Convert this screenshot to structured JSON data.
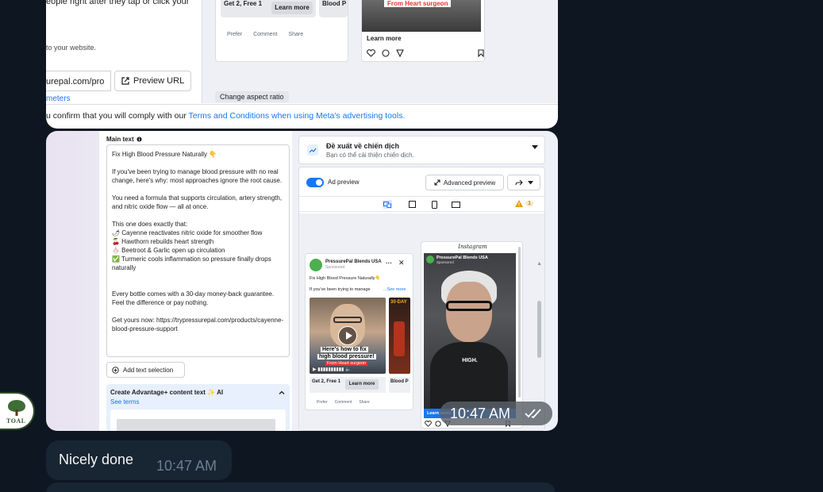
{
  "top_screenshot": {
    "left_text_1": "eople right after they tap or click your",
    "left_text_2": "to your website.",
    "url_value": "urepal.com/pro",
    "preview_url_label": "Preview URL",
    "parameters_link": "meters",
    "fb_card": {
      "get2free": "Get 2, Free 1",
      "learn_more": "Learn more",
      "blood_p": "Blood P",
      "actions": [
        "Prefer",
        "Comment",
        "Share"
      ]
    },
    "ig_card": {
      "video_caption": "From Heart surgeon",
      "learn_more": "Learn more"
    },
    "change_aspect_label": "Change aspect ratio",
    "terms_prefix": "u confirm that you will comply with our ",
    "terms_link": "Terms and Conditions when using Meta's advertising tools."
  },
  "editor": {
    "main_text_label": "Main text",
    "paragraphs": [
      "Fix High Blood Pressure Naturally 👇",
      "If you've been trying to manage blood pressure with no real change, here's why: most approaches ignore the root cause.",
      "You need a formula that supports circulation, artery strength, and nitric oxide flow — all at once.",
      "This one does exactly that:",
      "Every bottle comes with a 30-day money-back guarantee. Feel the difference or pay nothing.",
      "Get yours now: https://trypressurepal.com/products/cayenne-blood-pressure-support"
    ],
    "bullets": [
      "🌶 Cayenne reactivates nitric oxide for smoother flow",
      "🍒 Hawthorn rebuilds heart strength",
      "🧄 Beetroot & Garlic open up circulation",
      "✅ Turmeric cools inflammation so pressure finally drops naturally"
    ],
    "add_text_label": "Add text selection",
    "advantage_title": "Create Advantage+ content text ✨ AI",
    "see_terms": "See terms"
  },
  "strategy": {
    "title": "Đề xuất về chiến dịch",
    "subtitle": "Bạn có thể cải thiện chiến dịch."
  },
  "preview": {
    "ad_preview_label": "Ad preview",
    "advanced_preview_label": "Advanced preview",
    "warning_count": "1",
    "fb": {
      "page_name": "PressurePal Blends USA",
      "sponsored": "Sponsored",
      "headline": "Fix High Blood Pressure Naturally👇",
      "body": "If you've been trying to manage",
      "see_more": "...See more",
      "caption_1": "Here's how to fix",
      "caption_2": "high blood pressure!",
      "caption_3": "From Heart surgeon",
      "side_label": "30-DAY",
      "get2free": "Get 2, Free 1",
      "learn_more": "Learn more",
      "blood_p": "Blood P",
      "actions": [
        "Prefer",
        "Comment",
        "Share"
      ]
    },
    "ig": {
      "logo": "Instagram",
      "page_name": "PressurePal Blends USA",
      "sponsored": "Sponsored",
      "caption": "HIGH.",
      "learn_more": "Learn more"
    }
  },
  "chat": {
    "image_time": "10:47 AM",
    "message_text": "Nicely done",
    "message_time": "10:47 AM",
    "avatar_text": "TOAL"
  }
}
